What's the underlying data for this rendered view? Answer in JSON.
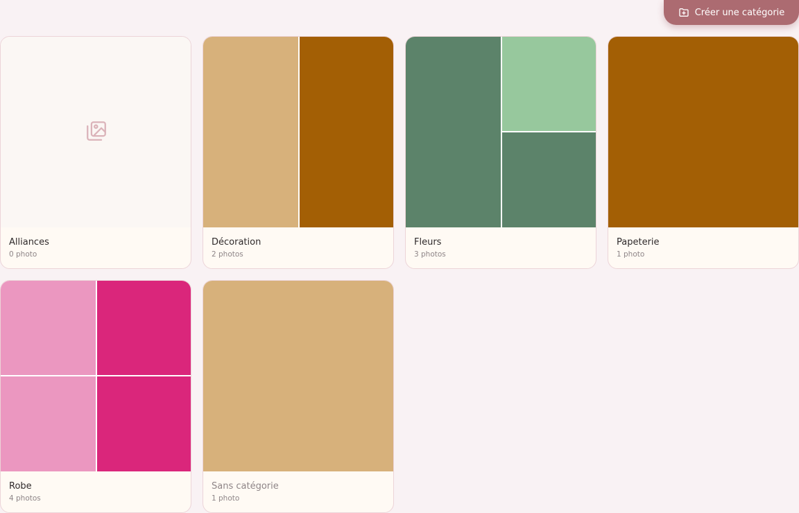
{
  "toolbar": {
    "create_label": "Créer une catégorie",
    "create_icon": "folder-plus-icon",
    "accent_color": "#ac6b71"
  },
  "categories": [
    {
      "name": "Alliances",
      "count_label": "0 photo",
      "tiles": []
    },
    {
      "name": "Décoration",
      "count_label": "2 photos",
      "tiles": [
        "#d7b17b",
        "#a35f05"
      ]
    },
    {
      "name": "Fleurs",
      "count_label": "3 photos",
      "tiles": [
        "#5c836a",
        "#97c89d",
        "#5c836a"
      ]
    },
    {
      "name": "Papeterie",
      "count_label": "1 photo",
      "tiles": [
        "#a35f05"
      ]
    },
    {
      "name": "Robe",
      "count_label": "4 photos",
      "tiles": [
        "#eb97c0",
        "#da267b",
        "#eb97c0",
        "#da267b"
      ]
    },
    {
      "name": "Sans catégorie",
      "count_label": "1 photo",
      "tiles": [
        "#d7b17b"
      ]
    }
  ],
  "empty_icon": "image-placeholder-icon"
}
